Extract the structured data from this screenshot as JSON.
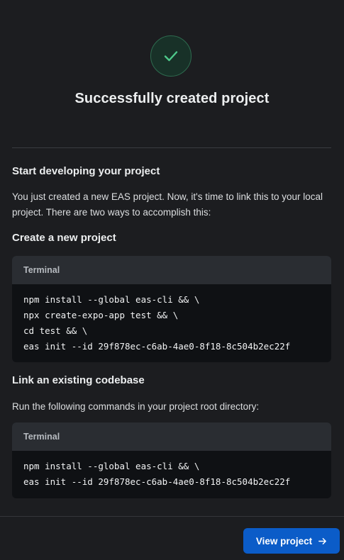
{
  "header": {
    "success_icon": "checkmark-icon",
    "title": "Successfully created project"
  },
  "intro": {
    "heading": "Start developing your project",
    "paragraph": "You just created a new EAS project. Now, it's time to link this to your local project. There are two ways to accomplish this:"
  },
  "new_project": {
    "heading": "Create a new project",
    "terminal_label": "Terminal",
    "commands": [
      "npm install --global eas-cli && \\",
      "npx create-expo-app test && \\",
      "cd test && \\",
      "eas init --id 29f878ec-c6ab-4ae0-8f18-8c504b2ec22f"
    ]
  },
  "existing_codebase": {
    "heading": "Link an existing codebase",
    "paragraph": "Run the following commands in your project root directory:",
    "terminal_label": "Terminal",
    "commands": [
      "npm install --global eas-cli && \\",
      "eas init --id 29f878ec-c6ab-4ae0-8f18-8c504b2ec22f"
    ]
  },
  "footer": {
    "view_button_label": "View project",
    "view_button_icon": "arrow-right-icon"
  },
  "colors": {
    "background": "#1c1d20",
    "success_green": "#4ec98b",
    "primary_button": "#0b5cc8",
    "terminal_body": "#0f1114",
    "terminal_header": "#2a2d32"
  }
}
